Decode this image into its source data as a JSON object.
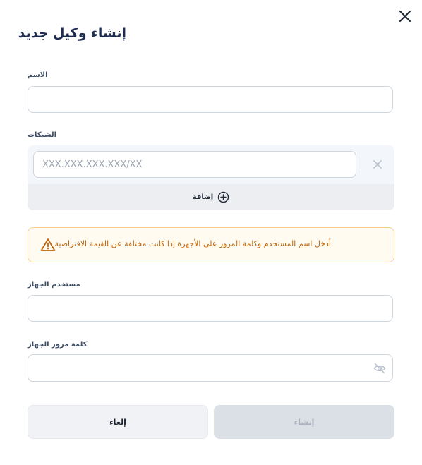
{
  "dialog": {
    "title": "إنشاء وكيل جديد",
    "close_icon": "close-icon"
  },
  "name_field": {
    "label": "الاسم",
    "value": ""
  },
  "networks": {
    "label": "الشبكات",
    "items": [
      {
        "placeholder": "XXX.XXX.XXX.XXX/XX",
        "value": ""
      }
    ],
    "remove_icon": "close-icon",
    "add_label": "إضافة",
    "add_icon": "plus-circle-icon"
  },
  "warning": {
    "text": "أدخل اسم المستخدم وكلمة المرور على الأجهزة إذا كانت مختلفة عن القيمة الافتراضية",
    "icon": "warning-triangle-icon",
    "border_color": "#f6d08a",
    "text_color": "#c2650a"
  },
  "device_user": {
    "label": "مستخدم الجهاز",
    "value": ""
  },
  "device_password": {
    "label": "كلمة مرور الجهاز",
    "value": "",
    "toggle_icon": "eye-off-icon"
  },
  "actions": {
    "cancel_label": "إلغاء",
    "create_label": "إنشاء",
    "create_disabled": true
  },
  "colors": {
    "title": "#1f2d4e",
    "panel_bg": "#f3f6fb",
    "add_bar_bg": "#eceef2",
    "create_bg": "#dbe0e6"
  }
}
